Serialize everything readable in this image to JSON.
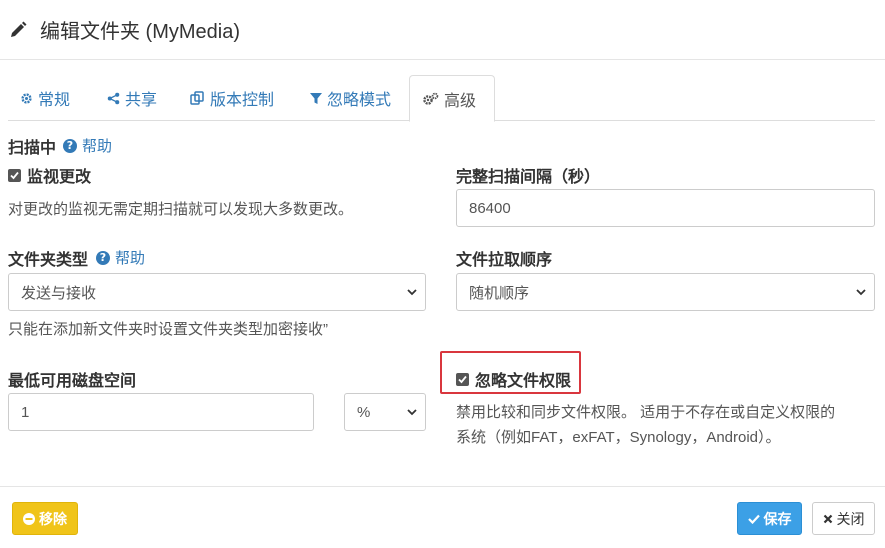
{
  "header": {
    "title": "编辑文件夹 (MyMedia)",
    "icon": "pencil-icon"
  },
  "tabs": [
    {
      "label": "常规",
      "icon": "gear-icon",
      "active": false
    },
    {
      "label": "共享",
      "icon": "share-icon",
      "active": false
    },
    {
      "label": "版本控制",
      "icon": "copy-icon",
      "active": false
    },
    {
      "label": "忽略模式",
      "icon": "filter-icon",
      "active": false
    },
    {
      "label": "高级",
      "icon": "gears-icon",
      "active": true
    }
  ],
  "scanning": {
    "title": "扫描中",
    "help_label": "帮助",
    "watch_label": "监视更改",
    "watch_checked": true,
    "watch_hint": "对更改的监视无需定期扫描就可以发现大多数更改。",
    "rescan_label": "完整扫描间隔（秒）",
    "rescan_value": "86400"
  },
  "folder_type": {
    "title": "文件夹类型",
    "help_label": "帮助",
    "selected": "发送与接收",
    "hint": "只能在添加新文件夹时设置文件夹类型加密接收”"
  },
  "pull_order": {
    "title": "文件拉取顺序",
    "selected": "随机顺序"
  },
  "min_disk": {
    "title": "最低可用磁盘空间",
    "value": "1",
    "unit": "%"
  },
  "ignore_perms": {
    "label": "忽略文件权限",
    "checked": true,
    "hint_line1": "禁用比较和同步文件权限。 适用于不存在或自定义权限的",
    "hint_line2": "系统（例如FAT，exFAT，Synology，Android）。",
    "highlight_color": "#d9363e"
  },
  "footer": {
    "remove_label": "移除",
    "save_label": "保存",
    "close_label": "关闭"
  },
  "colors": {
    "link": "#337ab7",
    "remove_button": "#f0c419",
    "save_button": "#3ca0e6"
  }
}
